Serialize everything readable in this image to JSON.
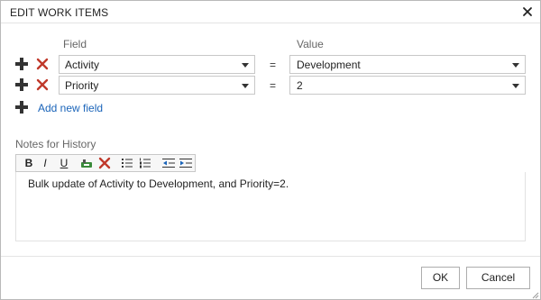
{
  "dialog": {
    "title": "EDIT WORK ITEMS",
    "close_icon": "close-icon"
  },
  "columns": {
    "field_header": "Field",
    "value_header": "Value"
  },
  "rows": [
    {
      "field": "Activity",
      "operator": "=",
      "value": "Development"
    },
    {
      "field": "Priority",
      "operator": "=",
      "value": "2"
    }
  ],
  "add_field": {
    "label": "Add new field",
    "icon": "plus-icon"
  },
  "notes": {
    "label": "Notes for History",
    "toolbar": {
      "bold_label": "B",
      "italic_label": "I",
      "underline_label": "U",
      "icons": [
        "bold-icon",
        "italic-icon",
        "underline-icon",
        "insert-link-icon",
        "remove-link-icon",
        "bulleted-list-icon",
        "numbered-list-icon",
        "decrease-indent-icon",
        "increase-indent-icon"
      ]
    },
    "text": "Bulk update of Activity to Development, and Priority=2."
  },
  "footer": {
    "ok_label": "OK",
    "cancel_label": "Cancel"
  },
  "colors": {
    "link": "#1a64b9",
    "remove_red": "#c0392b",
    "border": "#c8c8c8"
  }
}
